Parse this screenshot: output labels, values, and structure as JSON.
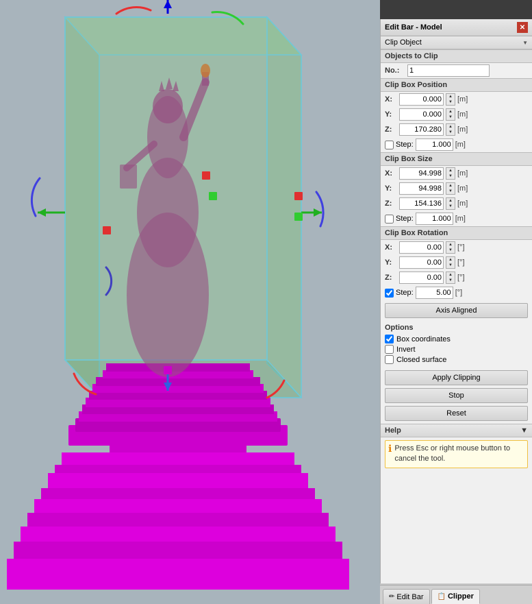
{
  "panel": {
    "title": "Edit Bar - Model",
    "close_label": "✕",
    "dropdown": {
      "label": "Clip Object",
      "arrow": "▼"
    },
    "objects_to_clip": {
      "section_title": "Objects to Clip",
      "no_label": "No.:",
      "no_value": "1"
    },
    "clip_box_position": {
      "title": "Clip Box Position",
      "x_label": "X:",
      "x_value": "0.000",
      "x_unit": "[m]",
      "y_label": "Y:",
      "y_value": "0.000",
      "y_unit": "[m]",
      "z_label": "Z:",
      "z_value": "170.280",
      "z_unit": "[m]",
      "step_label": "Step:",
      "step_value": "1.000",
      "step_unit": "[m]"
    },
    "clip_box_size": {
      "title": "Clip Box Size",
      "x_label": "X:",
      "x_value": "94.998",
      "x_unit": "[m]",
      "y_label": "Y:",
      "y_value": "94.998",
      "y_unit": "[m]",
      "z_label": "Z:",
      "z_value": "154.136",
      "z_unit": "[m]",
      "step_label": "Step:",
      "step_value": "1.000",
      "step_unit": "[m]"
    },
    "clip_box_rotation": {
      "title": "Clip Box Rotation",
      "x_label": "X:",
      "x_value": "0.00",
      "x_unit": "[°]",
      "y_label": "Y:",
      "y_value": "0.00",
      "y_unit": "[°]",
      "z_label": "Z:",
      "z_value": "0.00",
      "z_unit": "[°]",
      "step_label": "Step:",
      "step_value": "5.00",
      "step_unit": "[°]",
      "axis_aligned_btn": "Axis Aligned"
    },
    "options": {
      "title": "Options",
      "box_coordinates_label": "Box coordinates",
      "box_coordinates_checked": true,
      "invert_label": "Invert",
      "invert_checked": false,
      "closed_surface_label": "Closed surface",
      "closed_surface_checked": false
    },
    "buttons": {
      "apply_clipping": "Apply Clipping",
      "stop": "Stop",
      "reset": "Reset"
    },
    "help": {
      "title": "Help",
      "arrow": "▼",
      "message": "Press Esc or right mouse button to cancel the tool."
    },
    "tabs": {
      "edit_bar": "Edit Bar",
      "clipper": "Clipper"
    }
  }
}
